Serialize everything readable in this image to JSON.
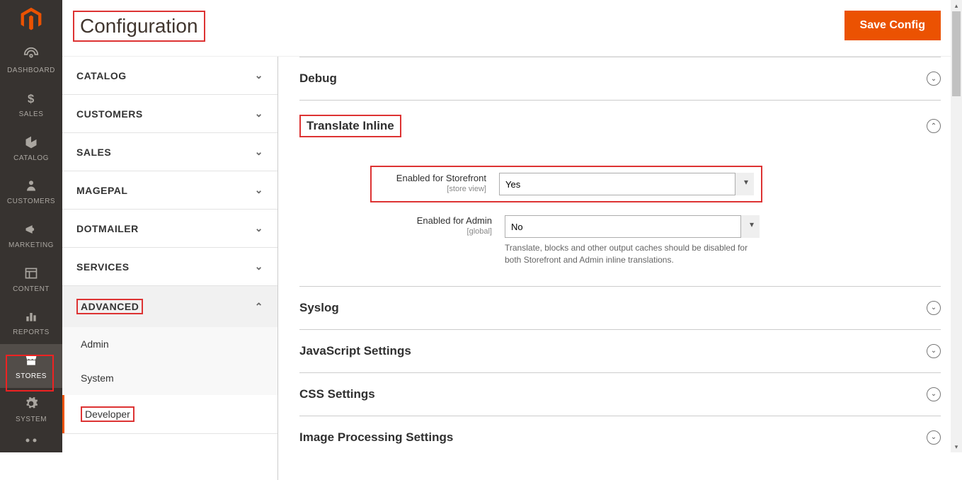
{
  "admin_nav": {
    "items": [
      {
        "label": "DASHBOARD",
        "icon": "gauge"
      },
      {
        "label": "SALES",
        "icon": "dollar"
      },
      {
        "label": "CATALOG",
        "icon": "cube"
      },
      {
        "label": "CUSTOMERS",
        "icon": "person"
      },
      {
        "label": "MARKETING",
        "icon": "megaphone"
      },
      {
        "label": "CONTENT",
        "icon": "layout"
      },
      {
        "label": "REPORTS",
        "icon": "bars"
      },
      {
        "label": "STORES",
        "icon": "storefront",
        "active": true
      },
      {
        "label": "SYSTEM",
        "icon": "gear"
      }
    ]
  },
  "header": {
    "title": "Configuration",
    "save_label": "Save Config"
  },
  "config_nav": {
    "groups": [
      {
        "label": "CATALOG",
        "expanded": false
      },
      {
        "label": "CUSTOMERS",
        "expanded": false
      },
      {
        "label": "SALES",
        "expanded": false
      },
      {
        "label": "MAGEPAL",
        "expanded": false
      },
      {
        "label": "DOTMAILER",
        "expanded": false
      },
      {
        "label": "SERVICES",
        "expanded": false
      },
      {
        "label": "ADVANCED",
        "expanded": true,
        "items": [
          {
            "label": "Admin",
            "active": false
          },
          {
            "label": "System",
            "active": false
          },
          {
            "label": "Developer",
            "active": true
          }
        ]
      }
    ]
  },
  "sections": {
    "debug": {
      "title": "Debug"
    },
    "translate_inline": {
      "title": "Translate Inline",
      "fields": {
        "storefront": {
          "label": "Enabled for Storefront",
          "scope": "[store view]",
          "value": "Yes"
        },
        "admin": {
          "label": "Enabled for Admin",
          "scope": "[global]",
          "value": "No",
          "note": "Translate, blocks and other output caches should be disabled for both Storefront and Admin inline translations."
        }
      }
    },
    "syslog": {
      "title": "Syslog"
    },
    "javascript": {
      "title": "JavaScript Settings"
    },
    "css": {
      "title": "CSS Settings"
    },
    "image_processing": {
      "title": "Image Processing Settings"
    }
  }
}
